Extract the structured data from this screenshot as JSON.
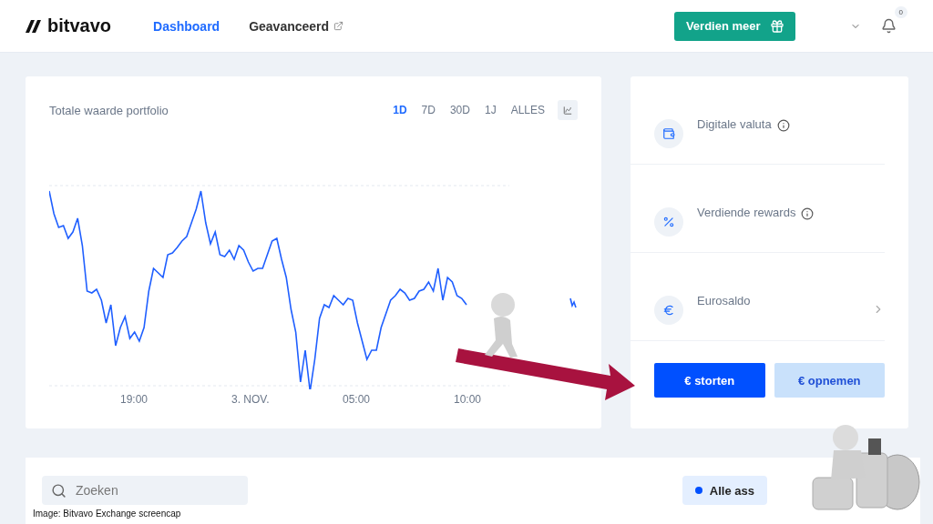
{
  "header": {
    "logo": "bitvavo",
    "nav": [
      {
        "label": "Dashboard",
        "selected": true,
        "external": false
      },
      {
        "label": "Geavanceerd",
        "selected": false,
        "external": true
      }
    ],
    "cta": "Verdien meer",
    "notification_count": "0"
  },
  "portfolio": {
    "title": "Totale waarde portfolio",
    "ranges": [
      {
        "label": "1D",
        "selected": true
      },
      {
        "label": "7D",
        "selected": false
      },
      {
        "label": "30D",
        "selected": false
      },
      {
        "label": "1J",
        "selected": false
      },
      {
        "label": "ALLES",
        "selected": false
      }
    ],
    "x_labels": [
      "19:00",
      "3. NOV.",
      "05:00",
      "10:00"
    ]
  },
  "balances": [
    {
      "kind": "wallet",
      "label": "Digitale valuta",
      "info": true,
      "chevron": false
    },
    {
      "kind": "percent",
      "label": "Verdiende rewards",
      "info": true,
      "chevron": false
    },
    {
      "kind": "euro",
      "label": "Eurosaldo",
      "info": false,
      "chevron": true
    }
  ],
  "actions": [
    {
      "label": "€ storten",
      "primary": true
    },
    {
      "label": "€ opnemen",
      "primary": false
    }
  ],
  "assets": {
    "search_placeholder": "Zoeken",
    "filter": "Alle ass"
  },
  "caption": "Image: Bitvavo Exchange screencap"
}
